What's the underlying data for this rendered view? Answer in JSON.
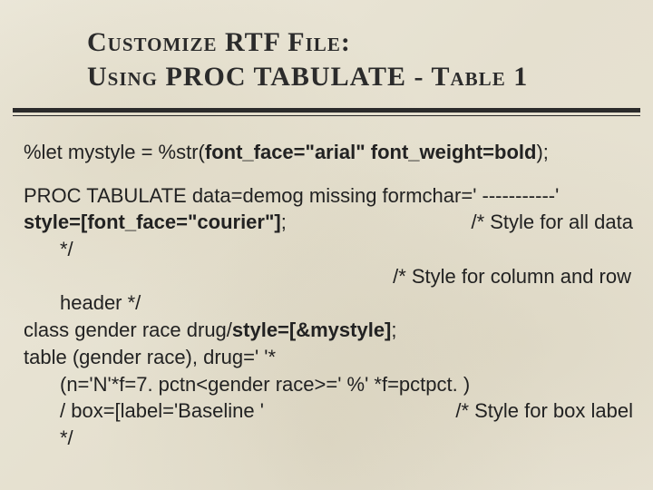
{
  "title": {
    "line1": "Customize RTF File:",
    "line2": "Using PROC TABULATE - Table 1"
  },
  "code": {
    "l1a": "%let mystyle = %str(",
    "l1b": "font_face=\"arial\" font_weight=bold",
    "l1c": ");",
    "l2": "PROC TABULATE data=demog missing  formchar=' -----------'",
    "l3a": " style=[font_face=\"courier\"]",
    "l3b": ";",
    "l3c": "/* Style for all data",
    "l4": "*/",
    "l5": "/* Style for column and row",
    "l6": "header */",
    "l7a": "class gender race drug/",
    "l7b": "style=[&mystyle]",
    "l7c": ";",
    "l8": "table (gender race), drug=' '*",
    "l9": "(n='N'*f=7.  pctn<gender race>='  %' *f=pctpct. )",
    "l10a": "/ box=[label='Baseline '",
    "l10b": "/* Style for box label",
    "l11": "*/"
  }
}
